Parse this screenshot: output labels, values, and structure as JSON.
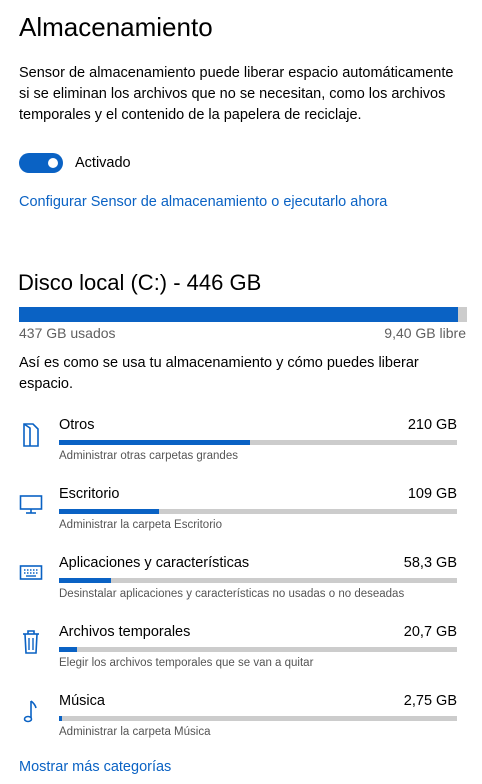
{
  "header": {
    "title": "Almacenamiento"
  },
  "storage_sense": {
    "description": "Sensor de almacenamiento puede liberar espacio automáticamente si se eliminan los archivos que no se necesitan, como los archivos temporales y el contenido de la papelera de reciclaje.",
    "toggle_state": "on",
    "toggle_label": "Activado",
    "config_link": "Configurar Sensor de almacenamiento o ejecutarlo ahora"
  },
  "disk": {
    "title": "Disco local (C:) - 446 GB",
    "used_label": "437 GB usados",
    "free_label": "9,40 GB libre",
    "used_fraction": 0.979,
    "usage_description": "Así es como se usa tu almacenamiento y cómo puedes liberar espacio."
  },
  "categories": [
    {
      "icon": "document-icon",
      "name": "Otros",
      "size": "210 GB",
      "fraction": 0.481,
      "subtitle": "Administrar otras carpetas grandes"
    },
    {
      "icon": "monitor-icon",
      "name": "Escritorio",
      "size": "109 GB",
      "fraction": 0.25,
      "subtitle": "Administrar la carpeta Escritorio"
    },
    {
      "icon": "keyboard-icon",
      "name": "Aplicaciones y características",
      "size": "58,3 GB",
      "fraction": 0.131,
      "subtitle": "Desinstalar aplicaciones y características no usadas o no deseadas"
    },
    {
      "icon": "trash-icon",
      "name": "Archivos temporales",
      "size": "20,7 GB",
      "fraction": 0.046,
      "subtitle": "Elegir los archivos temporales que se van a quitar"
    },
    {
      "icon": "music-note-icon",
      "name": "Música",
      "size": "2,75 GB",
      "fraction": 0.008,
      "subtitle": "Administrar la carpeta Música"
    }
  ],
  "more_link": "Mostrar más categorías",
  "colors": {
    "accent": "#0a62c4",
    "bar_track": "#cccccc",
    "secondary_text": "#606060"
  }
}
